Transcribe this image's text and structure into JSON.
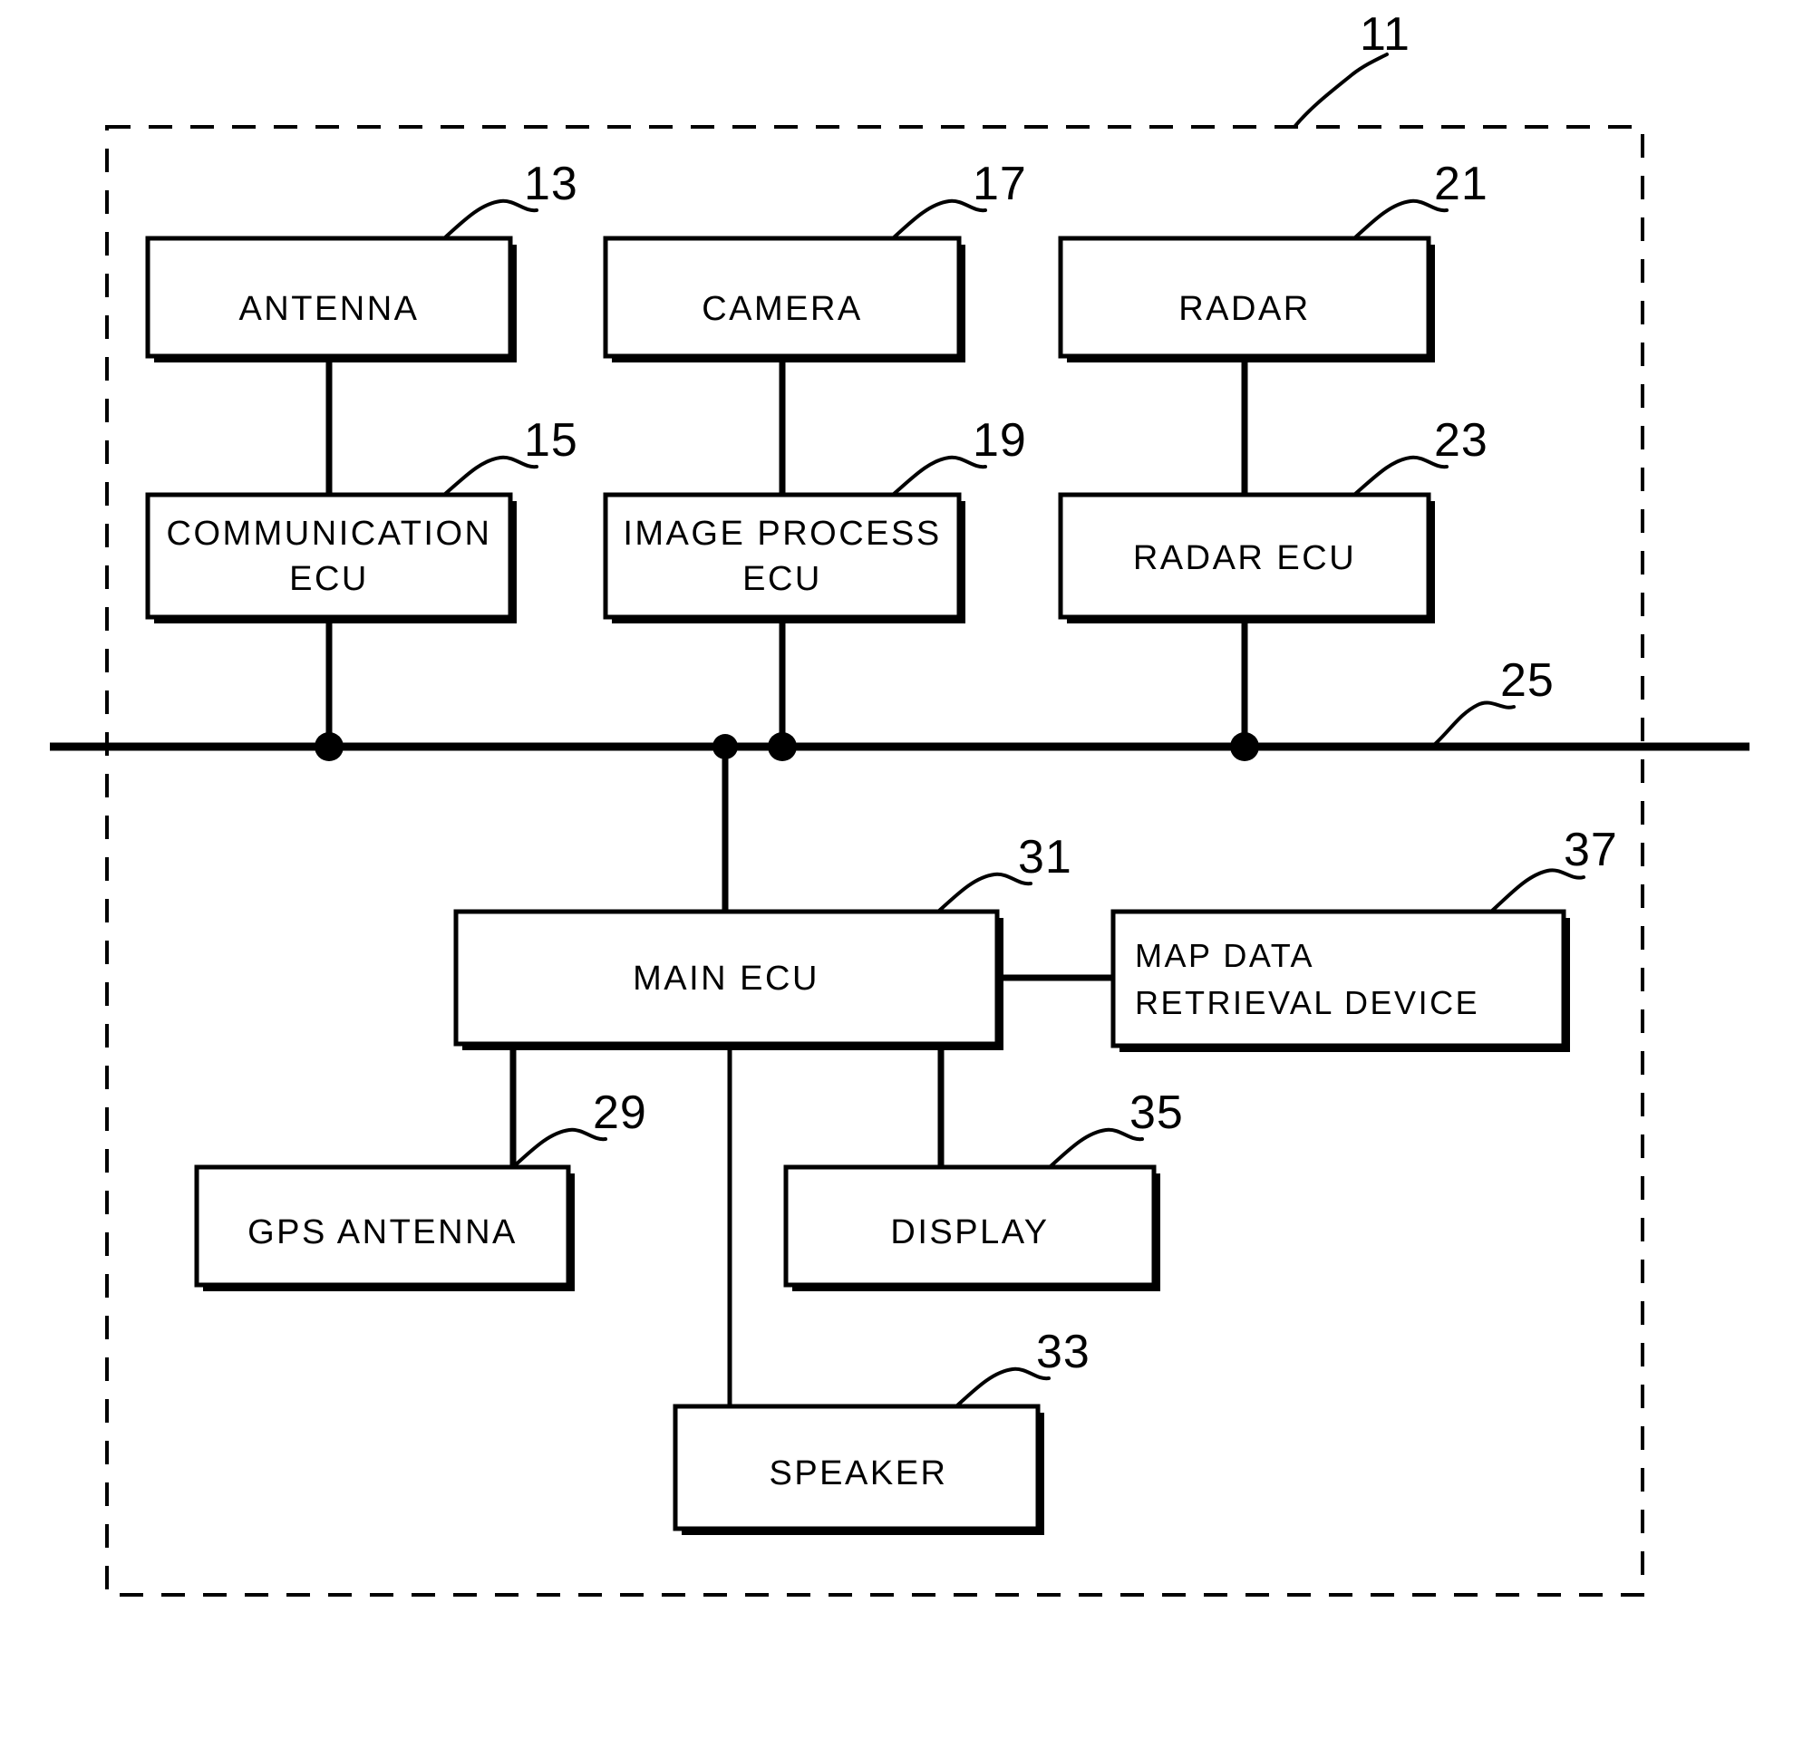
{
  "figure": {
    "type": "patent-block-diagram",
    "title": "",
    "system_ref": "11",
    "bus_ref": "25",
    "background_color": "#ffffff",
    "line_color": "#000000"
  },
  "blocks": [
    {
      "id": "antenna",
      "label": "ANTENNA",
      "ref": "13",
      "lines": [
        "ANTENNA"
      ]
    },
    {
      "id": "communication",
      "label": "COMMUNICATION ECU",
      "ref": "15",
      "lines": [
        "COMMUNICATION",
        "ECU"
      ]
    },
    {
      "id": "camera",
      "label": "CAMERA",
      "ref": "17",
      "lines": [
        "CAMERA"
      ]
    },
    {
      "id": "image_process",
      "label": "IMAGE PROCESS ECU",
      "ref": "19",
      "lines": [
        "IMAGE PROCESS",
        "ECU"
      ]
    },
    {
      "id": "radar",
      "label": "RADAR",
      "ref": "21",
      "lines": [
        "RADAR"
      ]
    },
    {
      "id": "radar_ecu",
      "label": "RADAR ECU",
      "ref": "23",
      "lines": [
        "RADAR ECU"
      ]
    },
    {
      "id": "main_ecu",
      "label": "MAIN ECU",
      "ref": "31",
      "lines": [
        "MAIN ECU"
      ]
    },
    {
      "id": "map_data",
      "label": "MAP DATA RETRIEVAL DEVICE",
      "ref": "37",
      "lines": [
        "MAP DATA",
        "RETRIEVAL DEVICE"
      ]
    },
    {
      "id": "gps_antenna",
      "label": "GPS ANTENNA",
      "ref": "29",
      "lines": [
        "GPS ANTENNA"
      ]
    },
    {
      "id": "display",
      "label": "DISPLAY",
      "ref": "35",
      "lines": [
        "DISPLAY"
      ]
    },
    {
      "id": "speaker",
      "label": "SPEAKER",
      "ref": "33",
      "lines": [
        "SPEAKER"
      ]
    }
  ],
  "reference_numerals": {
    "system": "11",
    "antenna": "13",
    "communication_ecu": "15",
    "camera": "17",
    "image_process_ecu": "19",
    "radar": "21",
    "radar_ecu": "23",
    "bus": "25",
    "gps_antenna": "29",
    "main_ecu": "31",
    "speaker": "33",
    "display": "35",
    "map_data_retrieval_device": "37"
  },
  "labels": {
    "antenna": "ANTENNA",
    "camera": "CAMERA",
    "radar": "RADAR",
    "communication_l1": "COMMUNICATION",
    "communication_l2": "ECU",
    "image_process_l1": "IMAGE PROCESS",
    "image_process_l2": "ECU",
    "radar_ecu": "RADAR ECU",
    "main_ecu": "MAIN ECU",
    "map_data_l1": "MAP DATA",
    "map_data_l2": "RETRIEVAL DEVICE",
    "gps_antenna": "GPS ANTENNA",
    "display": "DISPLAY",
    "speaker": "SPEAKER"
  }
}
